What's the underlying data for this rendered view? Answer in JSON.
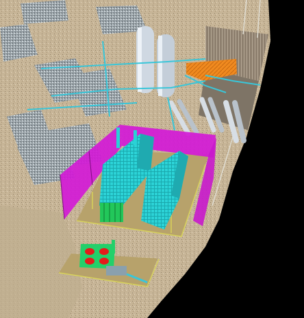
{
  "scene": {
    "colors": {
      "background": "#000000",
      "ground": "#cdbb9e",
      "gravel": "#b9a78a",
      "magenta_wall": "#d21ad6",
      "cyan_equipment": "#29d2d6",
      "concrete_pad": "#b5a06b",
      "pipe_cyan": "#39c6d9",
      "green_module": "#22c75a",
      "red_motor": "#e41b1b",
      "orange_roof": "#f08a1f",
      "yellow_rail": "#d7d25a",
      "silver_tank": "#cfd8e2"
    },
    "layers": [
      "point-cloud-ground",
      "point-cloud-industrial-plant",
      "cyan-pipe-rack-overlay",
      "magenta-enclosure-walls",
      "cyan-equipment-skids",
      "green-pump-module",
      "storage-tanks",
      "orange-roof-structure",
      "shed-roof-right"
    ]
  }
}
